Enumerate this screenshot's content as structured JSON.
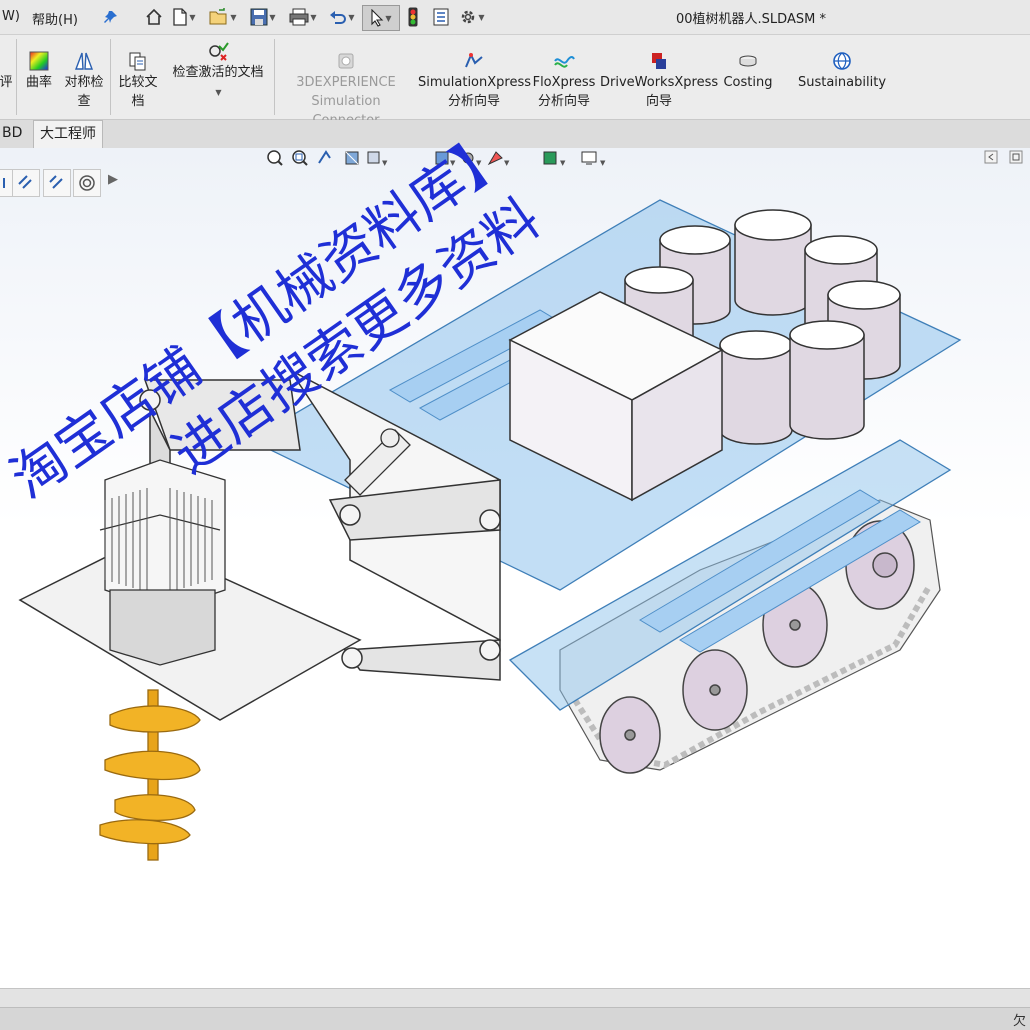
{
  "window": {
    "title": "00植树机器人.SLDASM *"
  },
  "menu": {
    "window_label": "W)",
    "help_label": "帮助(H)"
  },
  "ribbon": {
    "buttons": [
      {
        "label": "评"
      },
      {
        "label": "曲率"
      },
      {
        "label_line1": "对称检",
        "label_line2": "查"
      },
      {
        "label_line1": "比较文",
        "label_line2": "档"
      },
      {
        "label": "检查激活的文档"
      },
      {
        "label_line1": "3DEXPERIENCE",
        "label_line2": "Simulation Connector"
      },
      {
        "label_line1": "SimulationXpress",
        "label_line2": "分析向导"
      },
      {
        "label_line1": "FloXpress",
        "label_line2": "分析向导"
      },
      {
        "label_line1": "DriveWorksXpress",
        "label_line2": "向导"
      },
      {
        "label": "Costing"
      },
      {
        "label": "Sustainability"
      }
    ]
  },
  "tabs": [
    {
      "label": "BD",
      "active": false
    },
    {
      "label": "大工程师",
      "active": true
    }
  ],
  "statusbar": {
    "text": "欠"
  },
  "watermark": {
    "line1": "淘宝店铺【机械资料库】",
    "line2": "进店搜索更多资料"
  },
  "colors": {
    "watermark": "#1f2fd6",
    "accent": "#1f5fbf",
    "auger": "#e8a41a",
    "glass": "#8fc3ec"
  }
}
